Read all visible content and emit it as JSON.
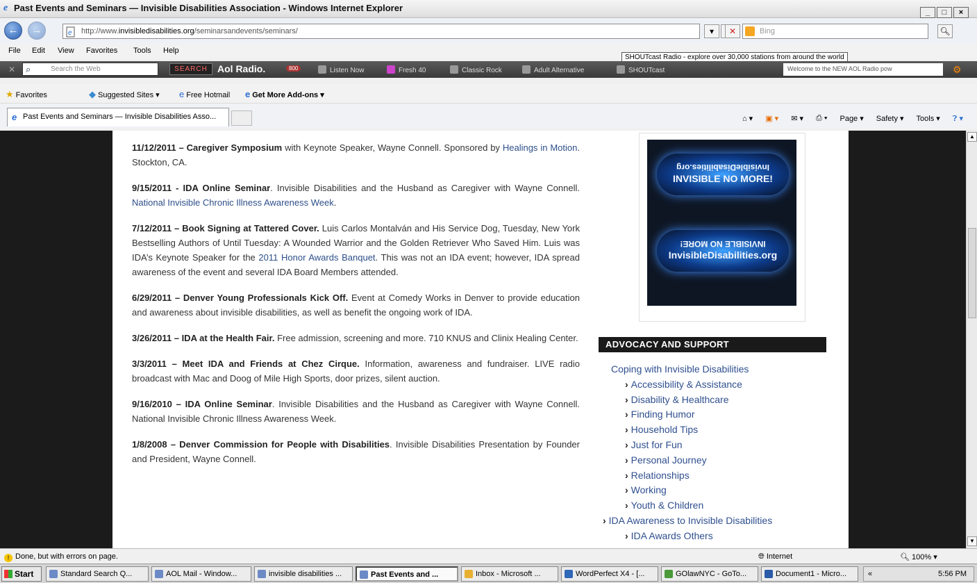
{
  "window": {
    "title": "Past Events and Seminars — Invisible Disabilities Association - Windows Internet Explorer",
    "buttons": [
      "_",
      "×"
    ]
  },
  "address": {
    "url_prefix": "http://www.",
    "url_domain": "invisibledisabilities.org",
    "url_path": "/seminarsandevents/seminars/",
    "search_placeholder": "Bing"
  },
  "menu": [
    "File",
    "Edit",
    "View",
    "Favorites",
    "Tools",
    "Help"
  ],
  "tooltip": "SHOUTcast Radio - explore over 30,000 stations from around the world",
  "aol": {
    "search_placeholder": "Search the Web",
    "search_button": "SEARCH",
    "radio_label": "Aol Radio.",
    "badge": "800",
    "items": [
      "Listen Now",
      "Fresh 40",
      "Classic Rock",
      "Adult Alternative",
      "SHOUTcast"
    ],
    "welcome": "Welcome to the NEW AOL Radio pow"
  },
  "favorites": {
    "label": "Favorites",
    "items": [
      "Suggested Sites",
      "Free Hotmail",
      "Get More Add-ons"
    ]
  },
  "tab": {
    "title": "Past Events and Seminars — Invisible Disabilities Asso..."
  },
  "commands": [
    "Page",
    "Safety",
    "Tools"
  ],
  "events": [
    {
      "head": "11/12/2011 – Caregiver Symposium",
      "text": " with Keynote Speaker, Wayne Connell. Sponsored by ",
      "link": "Healings in Motion",
      "tail": ". Stockton, CA."
    },
    {
      "head": "9/15/2011 - IDA Online Seminar",
      "text": ". Invisible Disabilities and the Husband as Caregiver with Wayne Connell. ",
      "link": "National Invisible Chronic Illness Awareness Week",
      "tail": "."
    },
    {
      "head": "7/12/2011 – Book Signing at Tattered Cover.",
      "text": " Luis Carlos Montalván and His Service Dog, Tuesday, New York Bestselling Authors of Until Tuesday: A Wounded Warrior and the Golden Retriever Who Saved Him. Luis was IDA’s Keynote Speaker for the ",
      "link": "2011 Honor Awards Banquet",
      "tail": ". This was not an IDA event; however, IDA spread awareness of the event and several IDA Board Members attended."
    },
    {
      "head": "6/29/2011 – Denver Young Professionals Kick Off.",
      "text": " Event at Comedy Works in Denver to provide education and awareness about invisible disabilities, as well as benefit the ongoing work of IDA.",
      "link": "",
      "tail": ""
    },
    {
      "head": "3/26/2011 – IDA at the Health Fair.",
      "text": " Free admission, screening and more. 710 KNUS and Clinix Healing Center.",
      "link": "",
      "tail": ""
    },
    {
      "head": "3/3/2011 – Meet IDA and Friends at Chez Cirque.",
      "text": " Information, awareness and fundraiser. LIVE radio broadcast with Mac and Doog of Mile High Sports, door prizes, silent auction.",
      "link": "",
      "tail": ""
    },
    {
      "head": "9/16/2010 – IDA Online Seminar",
      "text": ". Invisible Disabilities and the Husband as Caregiver with Wayne Connell. National Invisible Chronic Illness Awareness Week.",
      "link": "",
      "tail": ""
    },
    {
      "head": "1/8/2008 – Denver Commission for People with Disabilities",
      "text": ". Invisible Disabilities Presentation by Founder and President, Wayne Connell.",
      "link": "",
      "tail": ""
    }
  ],
  "banner": {
    "top_text": "INVISIBLE NO MORE!",
    "mirrored_text": "InvisibleDisabilities.org",
    "bottom_text": "InvisibleDisabilities.org"
  },
  "sidebar": {
    "heading": "ADVOCACY AND SUPPORT",
    "parent": "Coping with Invisible Disabilities",
    "children": [
      "Accessibility & Assistance",
      "Disability & Healthcare",
      "Finding Humor",
      "Household Tips",
      "Just for Fun",
      "Personal Journey",
      "Relationships",
      "Working",
      "Youth & Children"
    ],
    "parent2": "IDA Awareness to Invisible Disabilities",
    "children2": [
      "IDA Awards Others"
    ]
  },
  "status": {
    "message": "Done, but with errors on page.",
    "zone": "Internet",
    "zoom": "100%"
  },
  "taskbar": {
    "start": "Start",
    "tasks": [
      "Standard Search Q...",
      "AOL Mail - Window...",
      "invisible disabilities ...",
      "Past Events and ...",
      "Inbox - Microsoft ...",
      "WordPerfect X4 - [...",
      "GOlawNYC - GoTo...",
      "Document1 - Micro..."
    ],
    "clock": "5:56 PM"
  }
}
